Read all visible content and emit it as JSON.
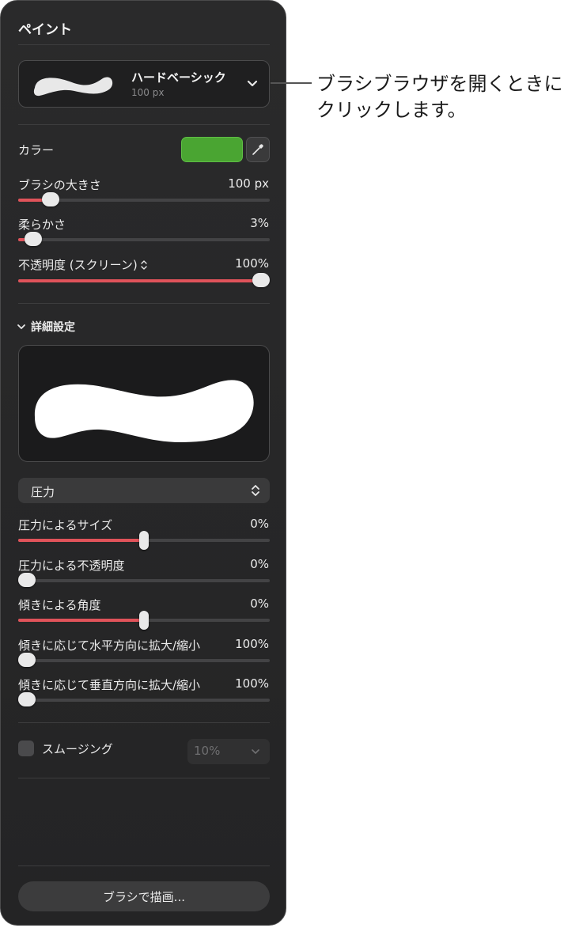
{
  "panel": {
    "title": "ペイント",
    "brush": {
      "name": "ハードベーシック",
      "size": "100 px"
    },
    "color": {
      "label": "カラー",
      "swatch": "#4aa532"
    },
    "sliders_top": [
      {
        "label": "ブラシの大きさ",
        "value": "100 px",
        "fraction": 0.13
      },
      {
        "label": "柔らかさ",
        "value": "3%",
        "fraction": 0.06
      },
      {
        "label": "不透明度 (スクリーン)",
        "value": "100%",
        "fraction": 1.0
      }
    ],
    "advanced": {
      "label": "詳細設定"
    },
    "pressure_select": "圧力",
    "sliders_bottom": [
      {
        "label": "圧力によるサイズ",
        "value": "0%",
        "fraction": 0.5
      },
      {
        "label": "圧力による不透明度",
        "value": "0%",
        "fraction": 0.0
      },
      {
        "label": "傾きによる角度",
        "value": "0%",
        "fraction": 0.5
      },
      {
        "label": "傾きに応じて水平方向に拡大/縮小",
        "value": "100%",
        "fraction": 0.0
      },
      {
        "label": "傾きに応じて垂直方向に拡大/縮小",
        "value": "100%",
        "fraction": 0.0
      }
    ],
    "smoothing": {
      "label": "スムージング",
      "value": "10%"
    },
    "draw_button": "ブラシで描画..."
  },
  "callout": {
    "text": "ブラシブラウザを開くときにクリックします。"
  },
  "colors": {
    "accent": "#e0535a",
    "swatch": "#4aa532"
  }
}
